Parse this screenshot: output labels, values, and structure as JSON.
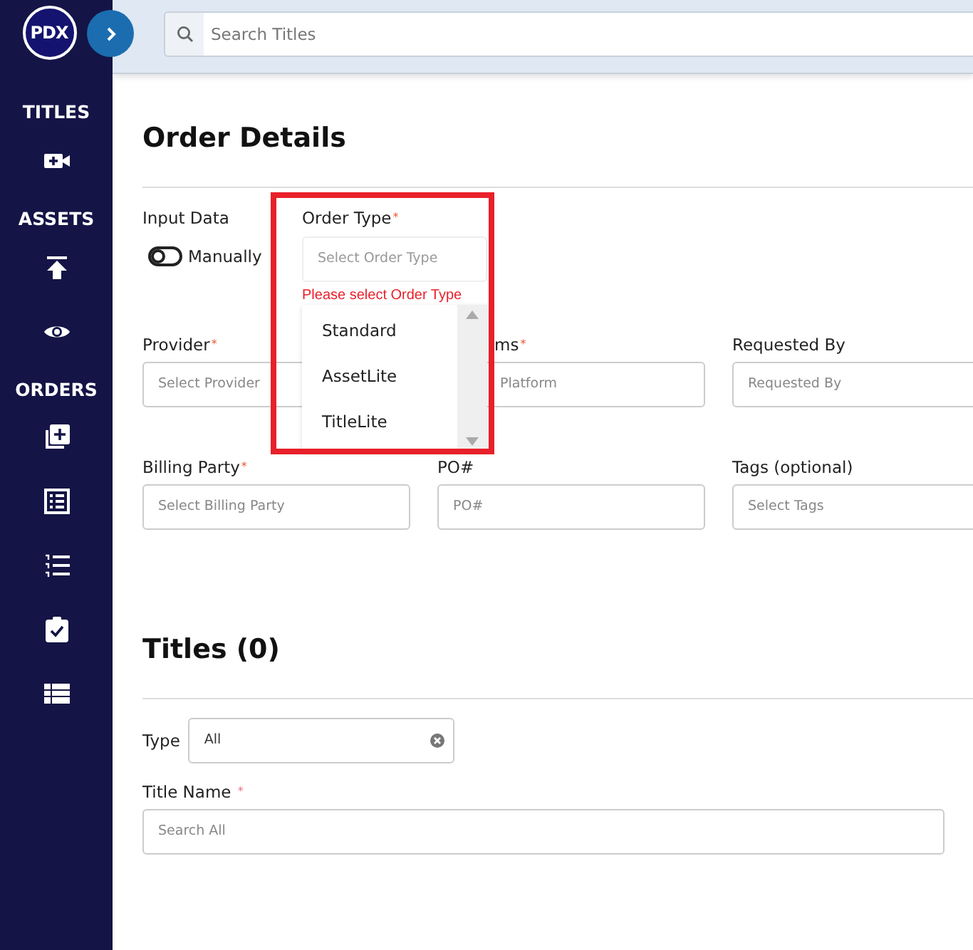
{
  "sidebar": {
    "logo": "PDX",
    "sections": [
      {
        "label": "TITLES",
        "items": [
          {
            "kind": "video"
          }
        ]
      },
      {
        "label": "ASSETS",
        "items": [
          {
            "kind": "upload"
          },
          {
            "kind": "view"
          }
        ]
      },
      {
        "label": "ORDERS",
        "items": [
          {
            "kind": "add"
          },
          {
            "kind": "sheet"
          },
          {
            "kind": "list"
          },
          {
            "kind": "clipboard"
          },
          {
            "kind": "table"
          }
        ]
      }
    ]
  },
  "search": {
    "placeholder": "Search Titles"
  },
  "order_details": {
    "title": "Order Details",
    "input_data": {
      "label": "Input Data",
      "toggle": {
        "label": "Manually",
        "on": false
      }
    },
    "order_type": {
      "label": "Order Type",
      "required_mark": "*",
      "placeholder": "Select Order Type",
      "error": "Please select Order Type",
      "options": [
        "Standard",
        "AssetLite",
        "TitleLite"
      ]
    },
    "fields": [
      {
        "label": "Provider",
        "required_mark": "*",
        "placeholder": "Select Provider"
      },
      {
        "label": "ms",
        "required_mark": "*",
        "placeholder": "Platform"
      },
      {
        "label": "Requested By",
        "placeholder": "Requested By"
      },
      {
        "label": "Billing Party",
        "required_mark": "*",
        "placeholder": "Select Billing Party"
      },
      {
        "label": "PO#",
        "placeholder": "PO#"
      },
      {
        "label": "Tags (optional)",
        "placeholder": "Select Tags"
      }
    ]
  },
  "titles": {
    "title": "Titles (0)",
    "type_filter": {
      "label": "Type",
      "value": "All"
    },
    "title_name": {
      "label": "Title Name",
      "required_mark": "*",
      "placeholder": "Search All"
    }
  }
}
